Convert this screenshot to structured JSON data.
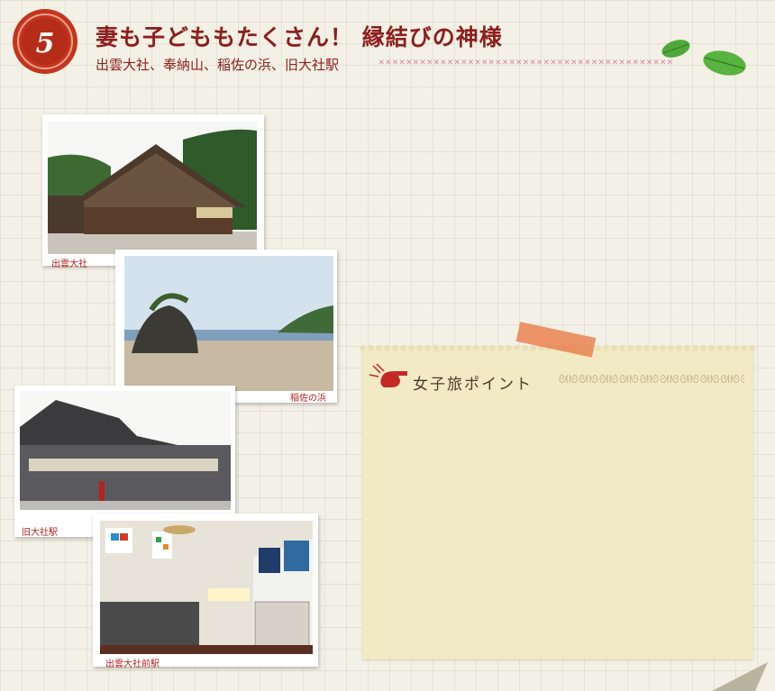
{
  "badge": {
    "number": "5"
  },
  "header": {
    "title": "妻も子どももたくさん！ 縁結びの神様",
    "subtitle": "出雲大社、奉納山、稲佐の浜、旧大社駅"
  },
  "photos": [
    {
      "caption": "出雲大社"
    },
    {
      "caption": "稲佐の浜"
    },
    {
      "caption": "旧大社駅"
    },
    {
      "caption": "出雲大社前駅"
    }
  ],
  "note": {
    "heading": "女子旅ポイント"
  },
  "colors": {
    "accent": "#8d1e1e",
    "badge": "#c4351e",
    "note_bg": "#f1eac4",
    "tape": "#ea8250"
  }
}
